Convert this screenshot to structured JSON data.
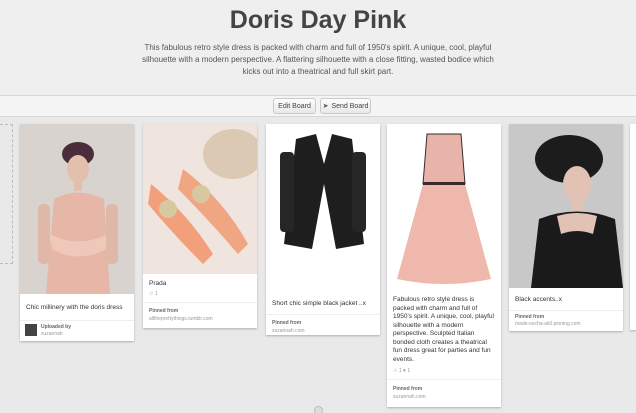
{
  "board": {
    "title": "Doris Day Pink",
    "description": "This fabulous retro style dress is packed with charm and full of 1950's spirit. A unique, cool, playful silhouette with a modern perspective. A flattering silhouette with a close fitting, wasted bodice which kicks out into a theatrical and full skirt part."
  },
  "toolbar": {
    "edit_label": "Edit Board",
    "send_label": "Send Board",
    "send_icon": "paper-plane-icon"
  },
  "pins": [
    {
      "description": "Chic millinery with the doris dress",
      "meta_title": "Uploaded by",
      "meta_sub": "suzannah"
    },
    {
      "description": "Prada",
      "stats": "♲ 1",
      "meta_title": "Pinned from",
      "meta_sub": "alltheprettythings.tumblr.com"
    },
    {
      "description": "Short chic simple black jacket ..x",
      "meta_title": "Pinned from",
      "meta_sub": "suzannah.com"
    },
    {
      "description": "Fabulous retro style dress is packed with charm and full of 1950's spirit. A unique, cool, playful silhouette with a modern perspective. Sculpted Italian bonded cloth creates a theatrical fun dress great for parties and fun events.",
      "stats": "♲ 1    ♥ 1",
      "meta_title": "Pinned from",
      "meta_sub": "suzannah.com"
    },
    {
      "description": "Black accents..x",
      "meta_title": "Pinned from",
      "meta_sub": "made-oscha-ak0.pinning.com"
    }
  ],
  "colors": {
    "background": "#e9e9e9",
    "card": "#ffffff",
    "title": "#444444"
  }
}
